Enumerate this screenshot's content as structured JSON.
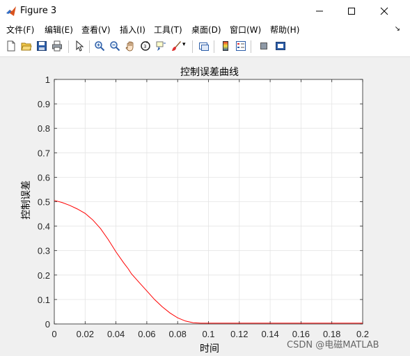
{
  "window": {
    "title": "Figure 3",
    "controls": [
      "minimize",
      "maximize",
      "close"
    ]
  },
  "menu": {
    "items": [
      "文件(F)",
      "编辑(E)",
      "查看(V)",
      "插入(I)",
      "工具(T)",
      "桌面(D)",
      "窗口(W)",
      "帮助(H)"
    ],
    "dock_arrow": "↘"
  },
  "toolbar": {
    "icons": [
      "new-figure-icon",
      "open-file-icon",
      "save-icon",
      "print-icon",
      "pointer-icon",
      "zoom-in-icon",
      "zoom-out-icon",
      "pan-icon",
      "rotate-3d-icon",
      "data-cursor-icon",
      "brush-icon",
      "link-plot-icon",
      "colorbar-icon",
      "legend-icon",
      "hide-plot-tools-icon",
      "show-plot-tools-icon"
    ]
  },
  "chart_data": {
    "type": "line",
    "title": "控制误差曲线",
    "xlabel": "时间",
    "ylabel": "控制误差",
    "xlim": [
      0,
      0.2
    ],
    "ylim": [
      0,
      1
    ],
    "x_ticks": [
      "0",
      "0.02",
      "0.04",
      "0.06",
      "0.08",
      "0.1",
      "0.12",
      "0.14",
      "0.16",
      "0.18",
      "0.2"
    ],
    "y_ticks": [
      "0",
      "0.1",
      "0.2",
      "0.3",
      "0.4",
      "0.5",
      "0.6",
      "0.7",
      "0.8",
      "0.9",
      "1"
    ],
    "grid": true,
    "line_color": "#ff0000",
    "x": [
      0,
      0.005,
      0.01,
      0.015,
      0.02,
      0.025,
      0.03,
      0.035,
      0.04,
      0.045,
      0.048,
      0.05,
      0.055,
      0.06,
      0.065,
      0.07,
      0.075,
      0.08,
      0.085,
      0.09,
      0.095,
      0.1,
      0.12,
      0.14,
      0.16,
      0.18,
      0.2
    ],
    "y": [
      0.505,
      0.497,
      0.485,
      0.47,
      0.452,
      0.425,
      0.39,
      0.345,
      0.295,
      0.25,
      0.225,
      0.205,
      0.17,
      0.135,
      0.1,
      0.07,
      0.045,
      0.025,
      0.012,
      0.005,
      0.003,
      0.003,
      0.003,
      0.003,
      0.003,
      0.003,
      0.003
    ]
  },
  "watermark": "CSDN @电磁MATLAB"
}
